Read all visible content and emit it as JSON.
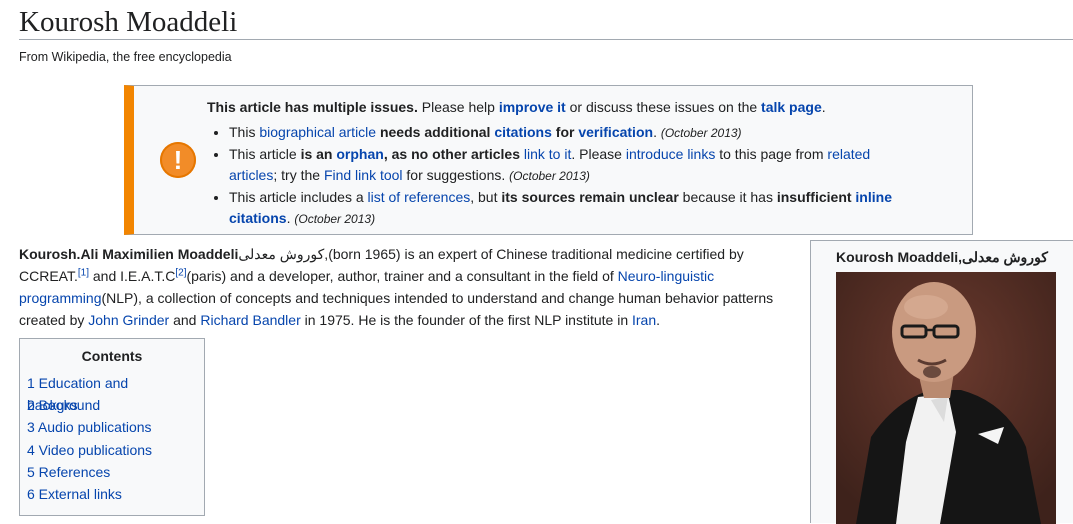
{
  "page": {
    "title": "Kourosh Moaddeli",
    "tagline": "From Wikipedia, the free encyclopedia"
  },
  "ambox": {
    "icon": "warning-exclamation-icon",
    "accent": "#f28500",
    "heading_bold": "This article has multiple issues.",
    "heading_text_1": " Please help ",
    "improve_link": "improve it",
    "heading_text_2": " or discuss these issues on the ",
    "talk_link": "talk page",
    "heading_text_3": ".",
    "issue1": {
      "t1": "This ",
      "link1": "biographical article",
      "t2": " needs additional ",
      "link2": "citations",
      "t3": " for ",
      "link3": "verification",
      "t4": ".",
      "date": "(October 2013)"
    },
    "issue2": {
      "t1": "This article ",
      "b1": "is an ",
      "link1": "orphan",
      "b2": ", as no other articles ",
      "link2": "link to it",
      "t2": ". Please ",
      "link3": "introduce links",
      "t3": " to this page from ",
      "link4": "related articles",
      "t4": "; try the ",
      "link5": "Find link tool",
      "t5": " for suggestions.",
      "date": "(October 2013)"
    },
    "issue3": {
      "t1": "This article includes a ",
      "link1": "list of references",
      "t2": ", but ",
      "b1": "its sources remain unclear",
      "t3": " because it has ",
      "b2": "insufficient ",
      "link2": "inline citations",
      "t4": ".",
      "date": "(October 2013)"
    }
  },
  "intro": {
    "name_bold": "Kourosh.Ali Maximilien Moaddeli",
    "native_name": ",کوروش معدلی",
    "t1": "(born 1965) is an expert of Chinese traditional medicine certified by CCREAT.",
    "ref1": "[1]",
    "t2": " and I.E.A.T.C",
    "ref2": "[2]",
    "t3": "(paris) and a developer, author, trainer and a consultant in the field of ",
    "link_nlp": "Neuro-linguistic programming",
    "t4": "(NLP), a collection of concepts and techniques intended to understand and change human behavior patterns created by ",
    "link_grinder": "John Grinder",
    "t5": " and ",
    "link_bandler": "Richard Bandler",
    "t6": " in 1975. He is the founder of the first NLP institute in ",
    "link_iran": "Iran",
    "t7": "."
  },
  "toc": {
    "title": "Contents",
    "items": [
      "1 Education and background",
      "2 Books",
      "3 Audio publications",
      "4 Video publications",
      "5 References",
      "6 External links"
    ]
  },
  "infobox": {
    "name": "Kourosh Moaddeli,کوروش معدلی"
  }
}
